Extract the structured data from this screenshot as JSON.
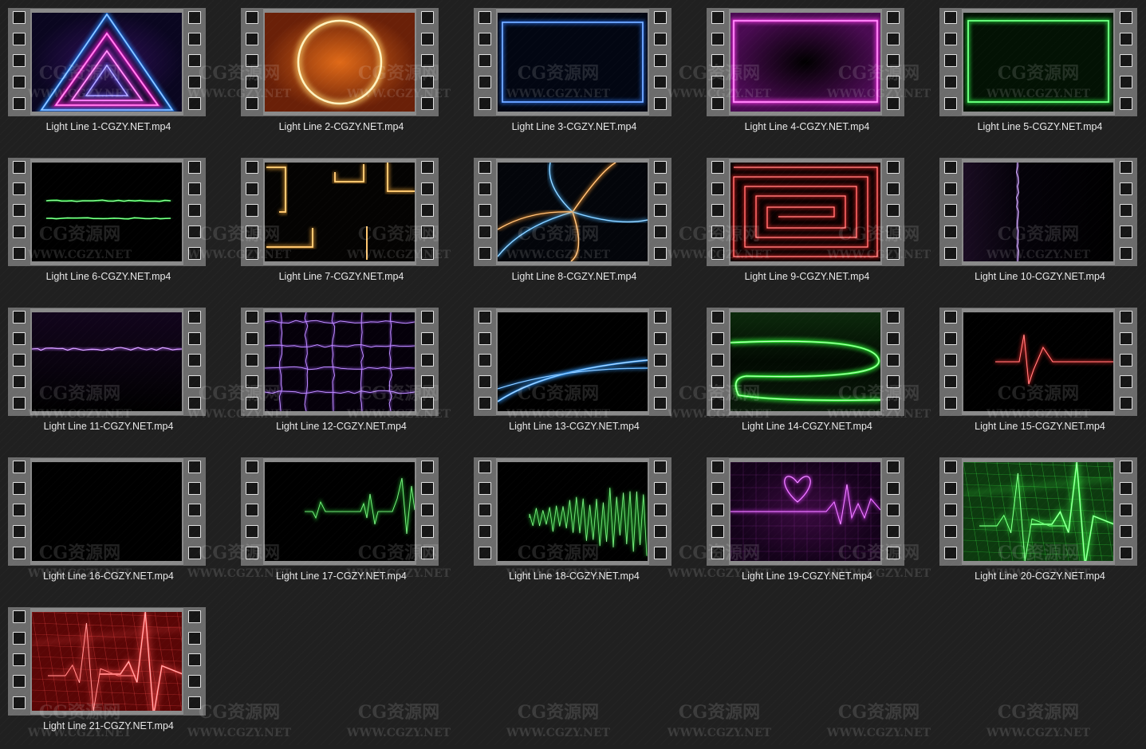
{
  "files": [
    {
      "name": "Light Line 1-CGZY.NET.mp4",
      "thumb": "neon-triangle"
    },
    {
      "name": "Light Line 2-CGZY.NET.mp4",
      "thumb": "fire-circle"
    },
    {
      "name": "Light Line 3-CGZY.NET.mp4",
      "thumb": "blue-frame"
    },
    {
      "name": "Light Line 4-CGZY.NET.mp4",
      "thumb": "magenta-frame"
    },
    {
      "name": "Light Line 5-CGZY.NET.mp4",
      "thumb": "green-frame"
    },
    {
      "name": "Light Line 6-CGZY.NET.mp4",
      "thumb": "green-double-lines"
    },
    {
      "name": "Light Line 7-CGZY.NET.mp4",
      "thumb": "orange-corners"
    },
    {
      "name": "Light Line 8-CGZY.NET.mp4",
      "thumb": "spiral-arms"
    },
    {
      "name": "Light Line 9-CGZY.NET.mp4",
      "thumb": "red-spiral-square"
    },
    {
      "name": "Light Line 10-CGZY.NET.mp4",
      "thumb": "purple-vertical-line"
    },
    {
      "name": "Light Line 11-CGZY.NET.mp4",
      "thumb": "purple-lightning-line"
    },
    {
      "name": "Light Line 12-CGZY.NET.mp4",
      "thumb": "purple-grid"
    },
    {
      "name": "Light Line 13-CGZY.NET.mp4",
      "thumb": "blue-curves"
    },
    {
      "name": "Light Line 14-CGZY.NET.mp4",
      "thumb": "green-s-curve"
    },
    {
      "name": "Light Line 15-CGZY.NET.mp4",
      "thumb": "red-heartbeat"
    },
    {
      "name": "Light Line 16-CGZY.NET.mp4",
      "thumb": "black"
    },
    {
      "name": "Light Line 17-CGZY.NET.mp4",
      "thumb": "green-heartbeat"
    },
    {
      "name": "Light Line 18-CGZY.NET.mp4",
      "thumb": "green-waveform"
    },
    {
      "name": "Light Line 19-CGZY.NET.mp4",
      "thumb": "purple-heart-monitor"
    },
    {
      "name": "Light Line 20-CGZY.NET.mp4",
      "thumb": "green-monitor"
    },
    {
      "name": "Light Line 21-CGZY.NET.mp4",
      "thumb": "red-monitor"
    }
  ],
  "watermark": {
    "line1": "CG资源网",
    "line2": "WWW.CGZY.NET"
  }
}
